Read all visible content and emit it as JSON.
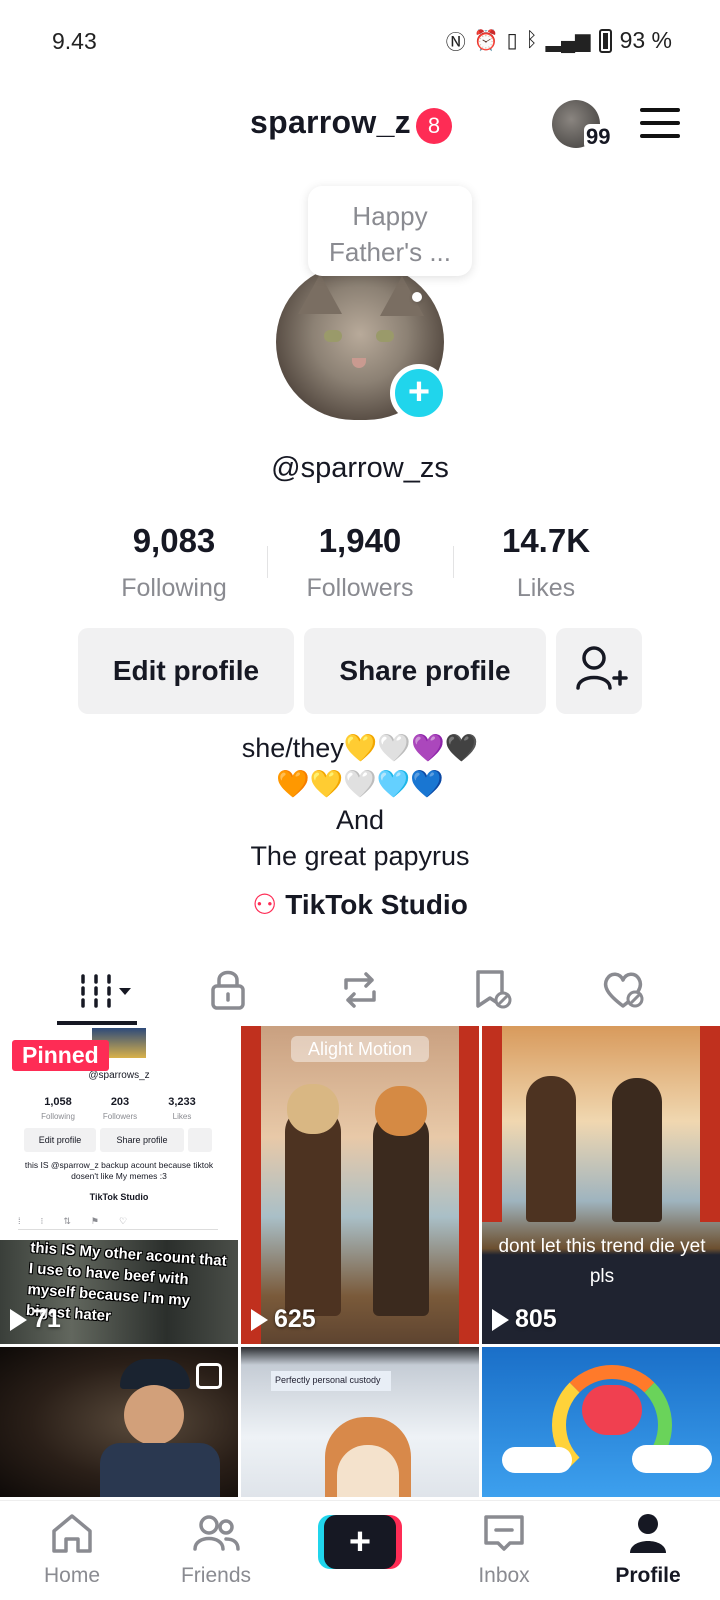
{
  "status_bar": {
    "time": "9.43",
    "icons": [
      "nfc-icon",
      "alarm-icon",
      "vibrate-icon",
      "bluetooth-icon",
      "5g-signal-icon",
      "battery-icon"
    ],
    "battery": "93 %"
  },
  "header": {
    "username": "sparrow_z",
    "notification_count": "8",
    "avatar_count": "99"
  },
  "profile": {
    "note": "Happy Father's ...",
    "handle": "@sparrow_zs"
  },
  "stats": [
    {
      "value": "9,083",
      "label": "Following"
    },
    {
      "value": "1,940",
      "label": "Followers"
    },
    {
      "value": "14.7K",
      "label": "Likes"
    }
  ],
  "actions": {
    "edit_label": "Edit profile",
    "share_label": "Share profile"
  },
  "bio": {
    "line1": "she/they💛🤍💜🖤",
    "line2": "🧡💛🤍🩵💙",
    "line3": "And",
    "line4": "The great papyrus"
  },
  "studio_label": "TikTok Studio",
  "tabs": [
    "videos",
    "private",
    "reposts",
    "favorites",
    "liked"
  ],
  "videos": [
    {
      "pinned_label": "Pinned",
      "views": "71",
      "inner_profile": {
        "handle": "@sparrows_z",
        "following": "1,058",
        "following_label": "Following",
        "followers": "203",
        "followers_label": "Followers",
        "likes": "3,233",
        "likes_label": "Likes",
        "edit": "Edit profile",
        "share": "Share profile",
        "bio": "this IS @sparrow_z backup acount because tiktok dosen't like My memes :3",
        "studio": "TikTok Studio"
      },
      "caption": "this IS My other acount that I use to have beef with myself because I'm my bigest hater"
    },
    {
      "views": "625",
      "watermark": "Alight Motion"
    },
    {
      "views": "805",
      "caption": "dont let this trend die yet pls"
    },
    {
      "views": ""
    },
    {
      "views": "",
      "caption": "Perfectly personal custody"
    },
    {
      "views": ""
    }
  ],
  "bottom_nav": {
    "home": "Home",
    "friends": "Friends",
    "inbox": "Inbox",
    "profile": "Profile"
  },
  "colors": {
    "accent_red": "#fe2c55",
    "accent_cyan": "#20d5ec",
    "text_primary": "#161823",
    "text_secondary": "#8a8b91"
  }
}
